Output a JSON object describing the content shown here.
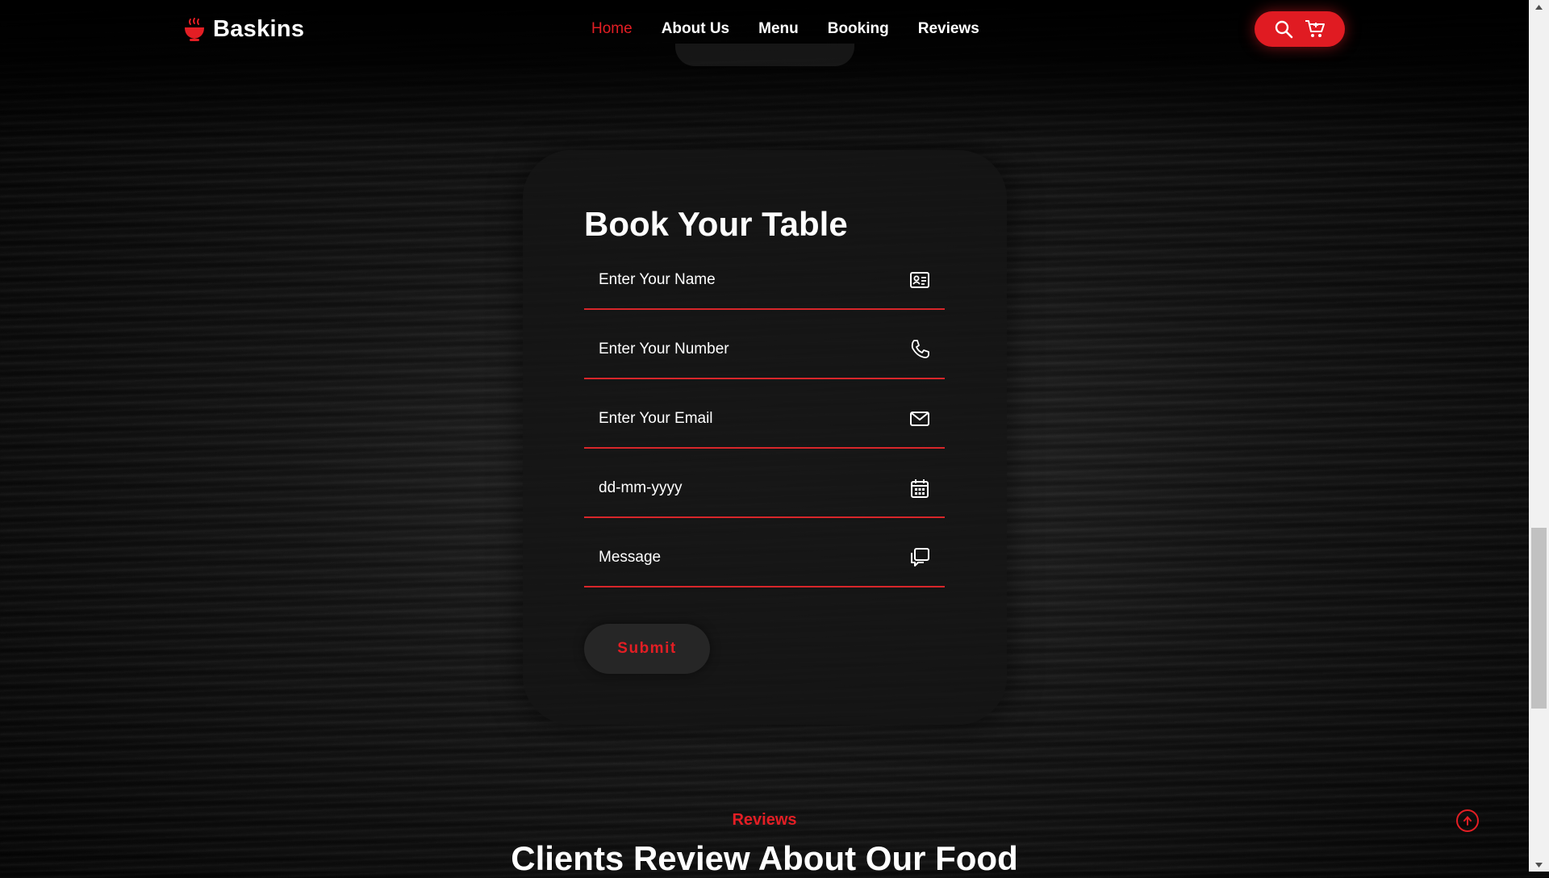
{
  "brand": {
    "name": "Baskins",
    "icon": "food-bowl-icon"
  },
  "nav": {
    "items": [
      {
        "label": "Home",
        "active": true
      },
      {
        "label": "About Us",
        "active": false
      },
      {
        "label": "Menu",
        "active": false
      },
      {
        "label": "Booking",
        "active": false
      },
      {
        "label": "Reviews",
        "active": false
      }
    ]
  },
  "header_actions": {
    "icons": [
      "search-icon",
      "cart-icon"
    ]
  },
  "booking": {
    "title": "Book Your Table",
    "fields": [
      {
        "placeholder": "Enter Your Name",
        "icon": "id-card-icon"
      },
      {
        "placeholder": "Enter Your Number",
        "icon": "phone-icon"
      },
      {
        "placeholder": "Enter Your Email",
        "icon": "mail-icon"
      },
      {
        "placeholder": "dd-mm-yyyy",
        "icon": "calendar-icon"
      },
      {
        "placeholder": "Message",
        "icon": "chat-icon"
      }
    ],
    "submit_label": "Submit"
  },
  "reviews": {
    "kicker": "Reviews",
    "heading": "Clients Review About Our Food"
  },
  "colors": {
    "accent": "#e31e24",
    "background": "#0b0b0b",
    "card": "#141414"
  }
}
